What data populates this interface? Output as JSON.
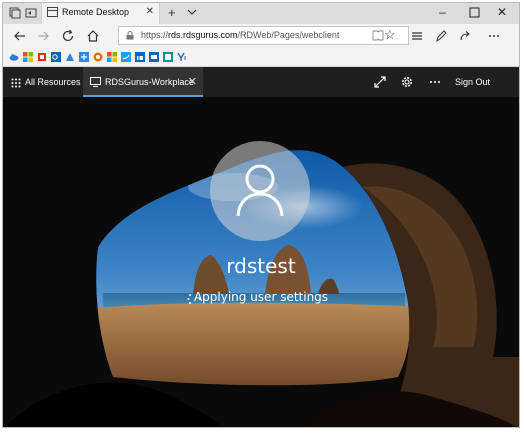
{
  "browser": {
    "tab_title": "Remote Desktop",
    "tab_close_icon": "close-icon",
    "new_tab_symbol": "+",
    "url_scheme": "https://",
    "url_domain": "rds.rdsgurus.com",
    "url_path": "/RDWeb/Pages/webclient"
  },
  "rdweb": {
    "all_resources_label": "All Resources",
    "active_tab_label": "RDSGurus-Workplace",
    "sign_out_label": "Sign Out"
  },
  "session": {
    "user_name": "rdstest",
    "status_text": "Applying user settings"
  }
}
